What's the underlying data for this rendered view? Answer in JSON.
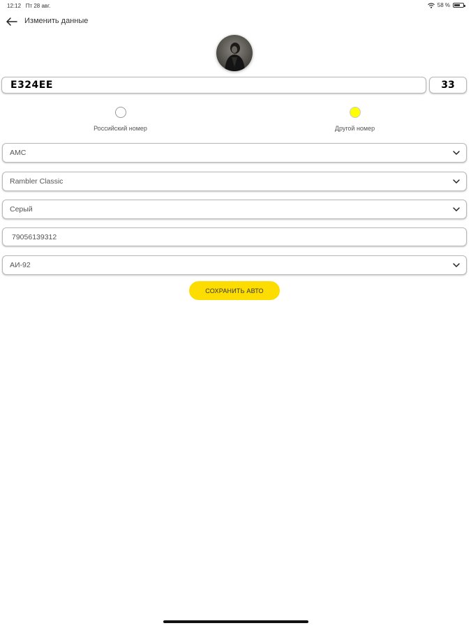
{
  "status_bar": {
    "time": "12:12",
    "date": "Пт 28 авг.",
    "battery": "58 %"
  },
  "header": {
    "back_icon": "arrow-left-icon",
    "title": "Изменить данные"
  },
  "plate": {
    "number": "E324EE",
    "region": "33"
  },
  "plate_type": {
    "options": [
      {
        "label": "Российский номер",
        "selected": false
      },
      {
        "label": "Другой номер",
        "selected": true
      }
    ]
  },
  "form": {
    "brand": "AMC",
    "model": "Rambler Classic",
    "color": "Серый",
    "phone": "79056139312",
    "fuel": "АИ-92"
  },
  "actions": {
    "save_label": "СОХРАНИТЬ АВТО"
  },
  "colors": {
    "accent": "#fddc00",
    "radio_selected": "#ffff00"
  }
}
